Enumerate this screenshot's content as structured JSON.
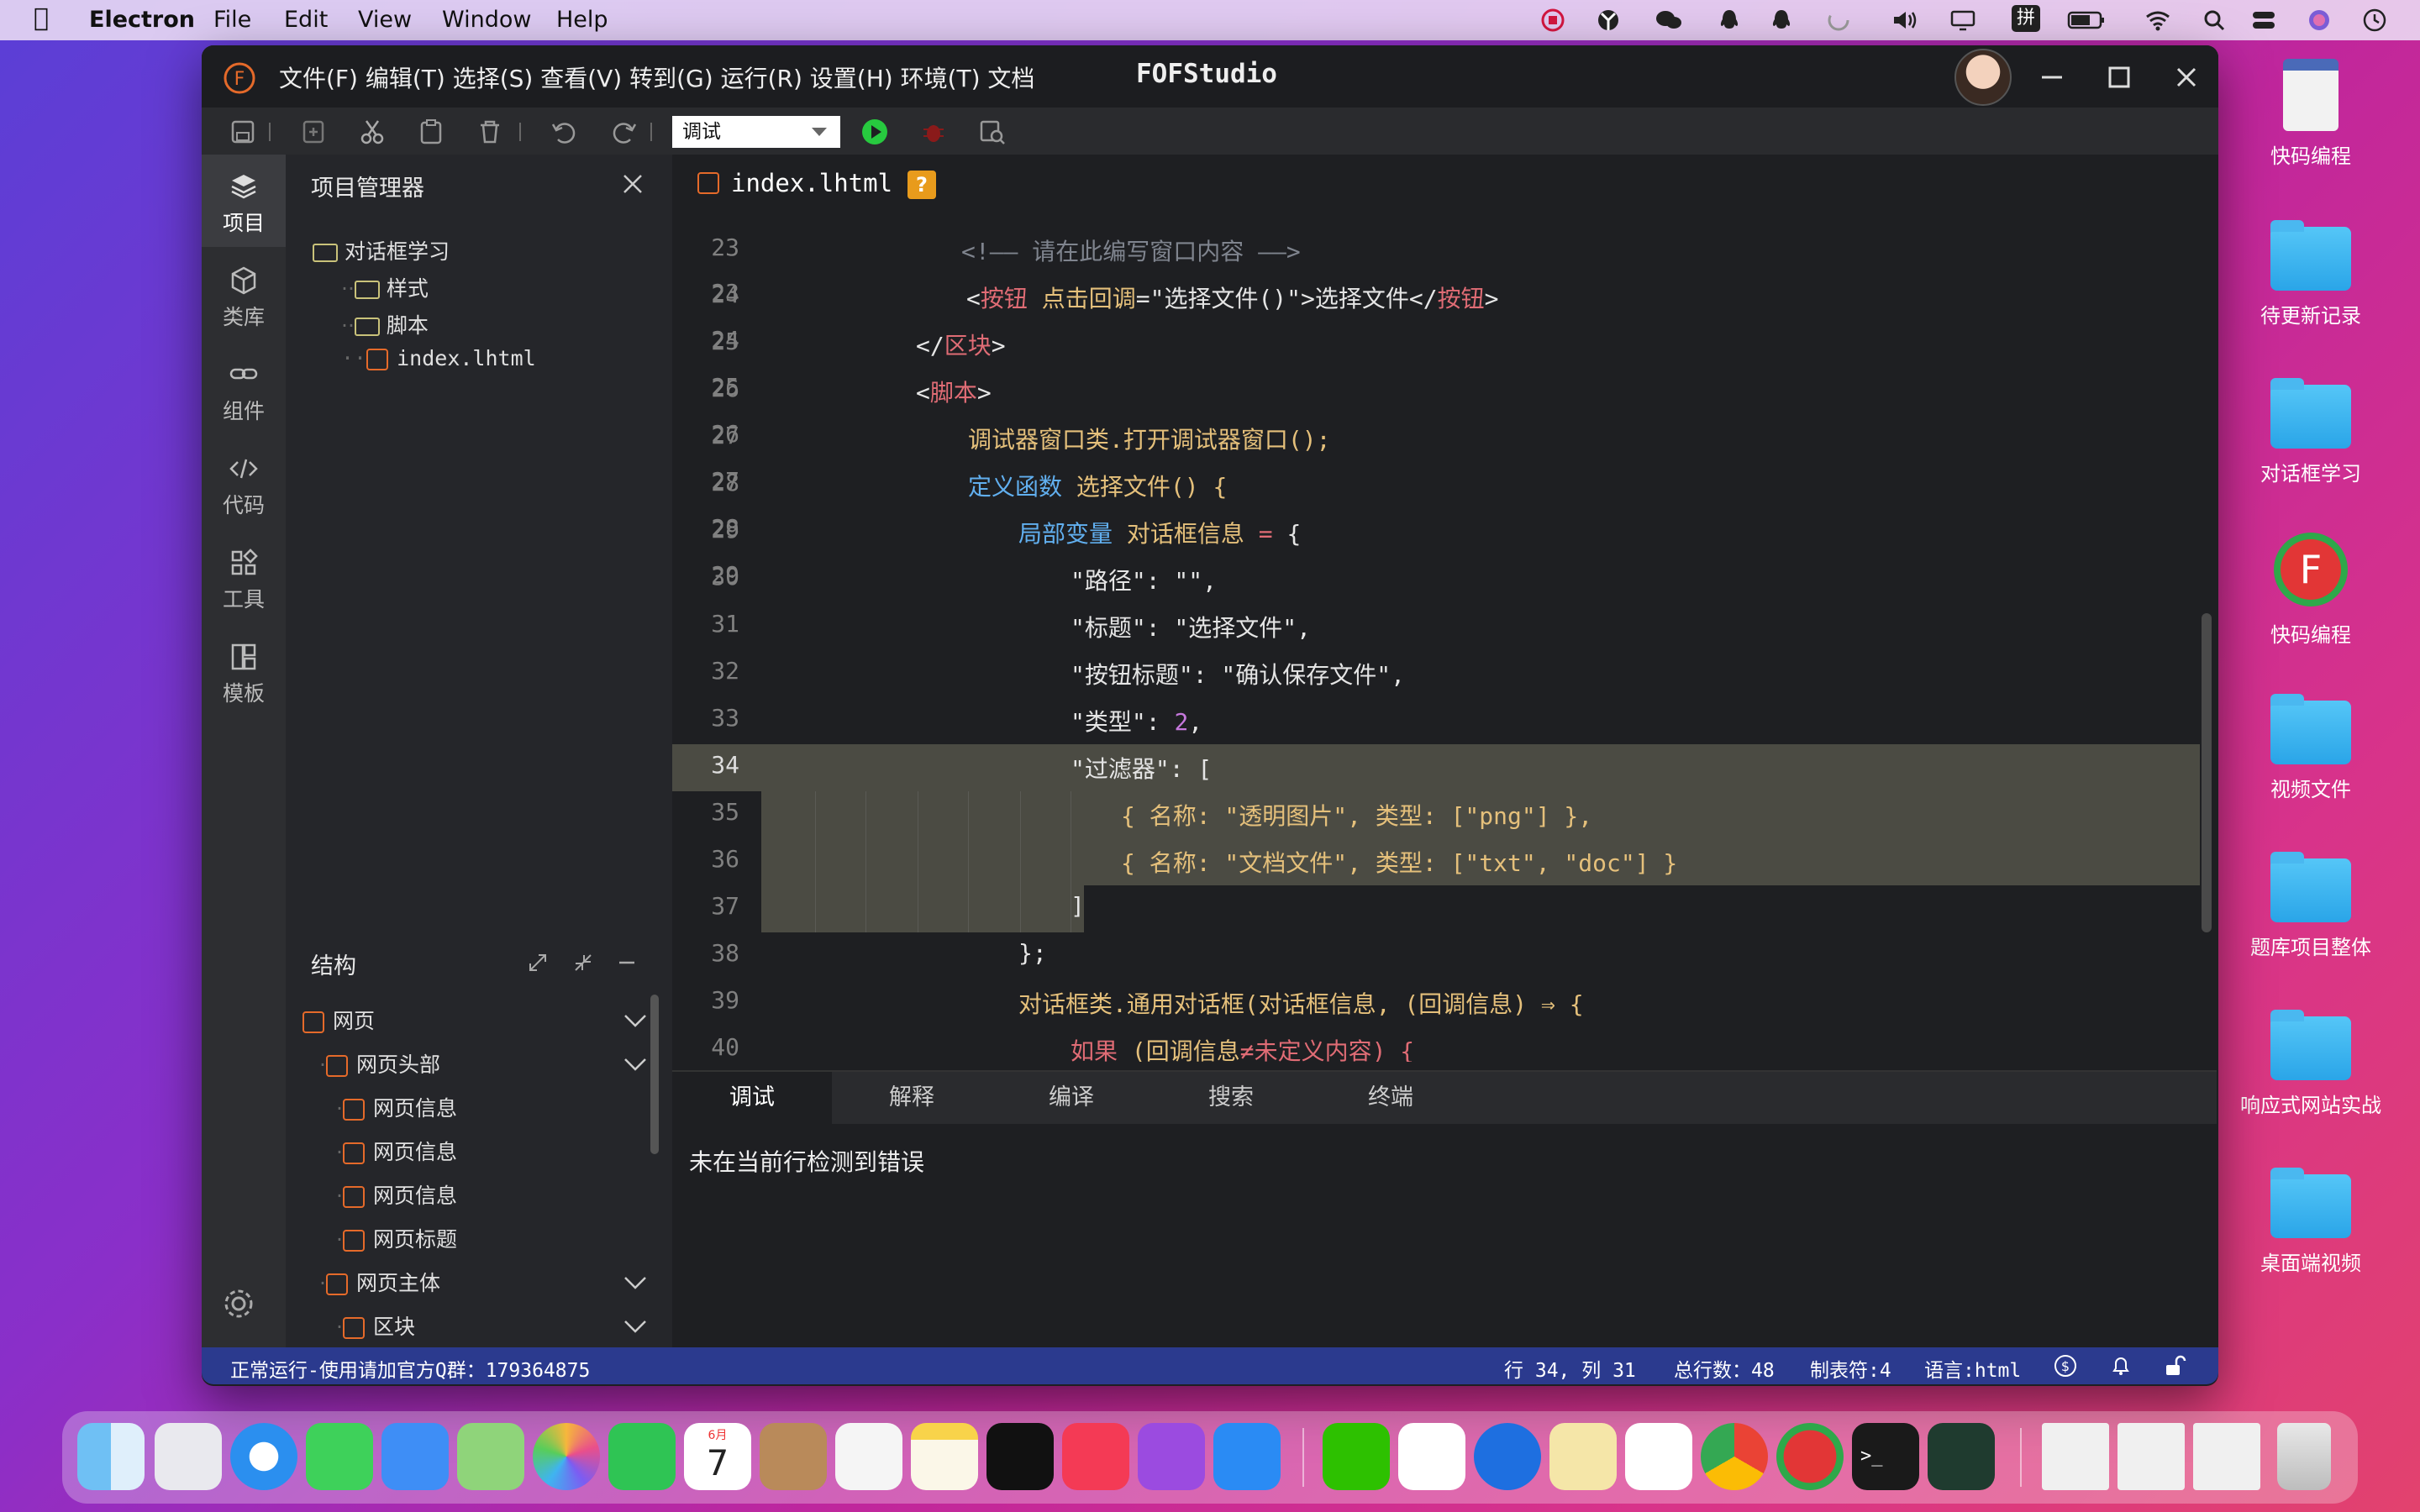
{
  "menubar": {
    "app": "Electron",
    "items": [
      "File",
      "Edit",
      "View",
      "Window",
      "Help"
    ]
  },
  "window": {
    "menu": "文件(F) 编辑(T) 选择(S) 查看(V) 转到(G) 运行(R) 设置(H) 环境(T) 文档",
    "title": "FOFStudio"
  },
  "toolbar": {
    "mode_select": "调试"
  },
  "leftbar": [
    {
      "label": "项目",
      "icon": "layers-icon"
    },
    {
      "label": "类库",
      "icon": "cube-icon"
    },
    {
      "label": "组件",
      "icon": "link-icon"
    },
    {
      "label": "代码",
      "icon": "code-icon"
    },
    {
      "label": "工具",
      "icon": "grid-icon"
    },
    {
      "label": "模板",
      "icon": "template-icon"
    }
  ],
  "project": {
    "title": "项目管理器",
    "root": "对话框学习",
    "children": [
      "样式",
      "脚本",
      "index.lhtml"
    ]
  },
  "structure": {
    "title": "结构",
    "items": [
      "网页",
      "网页头部",
      "网页信息",
      "网页信息",
      "网页信息",
      "网页标题",
      "网页主体",
      "区块"
    ]
  },
  "editor": {
    "tab": "index.lhtml",
    "tab_badge": "?"
  },
  "code": {
    "l23": "23",
    "l24": "24",
    "l25": "25",
    "l26": "26",
    "l27": "27",
    "l28": "28",
    "l29": "29",
    "l30": "30",
    "l31": "31",
    "l32": "32",
    "l33": "33",
    "l34": "34",
    "l35": "35",
    "l36": "36",
    "l37": "37",
    "l38": "38",
    "l39": "39",
    "l40": "40",
    "c23": "<!—— 请在此编写窗口内容 ——>",
    "c24a": "<",
    "c24b": "按钮",
    "c24c": " 点击回调",
    "c24d": "=\"选择文件()\">选择文件</",
    "c24e": "按钮",
    "c24f": ">",
    "c25a": "</",
    "c25b": "区块",
    "c25c": ">",
    "c26a": "<",
    "c26b": "脚本",
    "c26c": ">",
    "c27": "调试器窗口类.打开调试器窗口();",
    "c28a": "定义函数",
    "c28b": " 选择文件() {",
    "c29a": "局部变量",
    "c29b": " 对话框信息 ",
    "c29c": "=",
    "c29d": " {",
    "c30": "\"路径\": \"\",",
    "c31": "\"标题\": \"选择文件\",",
    "c32": "\"按钮标题\": \"确认保存文件\",",
    "c33a": "\"类型\": ",
    "c33b": "2",
    "c33c": ",",
    "c34": "\"过滤器\": [",
    "c35": "{ 名称: \"透明图片\", 类型: [\"png\"] },",
    "c36": "{ 名称: \"文档文件\", 类型: [\"txt\", \"doc\"] }",
    "c37": "]",
    "c38": "};",
    "c39a": "对话框类.通用对话框",
    "c39b": "(对话框信息, (回调信息) ⇒ {",
    "c40a": "如果",
    "c40b": " (回调信息",
    "c40c": "≠",
    "c40d": "未定义内容) {"
  },
  "bottom": {
    "tabs": [
      "调试",
      "解释",
      "编译",
      "搜索",
      "终端"
    ],
    "message": "未在当前行检测到错误"
  },
  "status": {
    "left": "正常运行-使用请加官方Q群：179364875",
    "pos": "行 34, 列 31",
    "lines": "总行数：48",
    "tab": "制表符:4",
    "lang": "语言:html"
  },
  "desktop": [
    "快码编程",
    "待更新记录",
    "对话框学习",
    "快码编程",
    "视频文件",
    "题库项目整体",
    "响应式网站实战",
    "桌面端视频"
  ],
  "dock": {
    "calendar_month": "6月",
    "calendar_day": "7"
  }
}
